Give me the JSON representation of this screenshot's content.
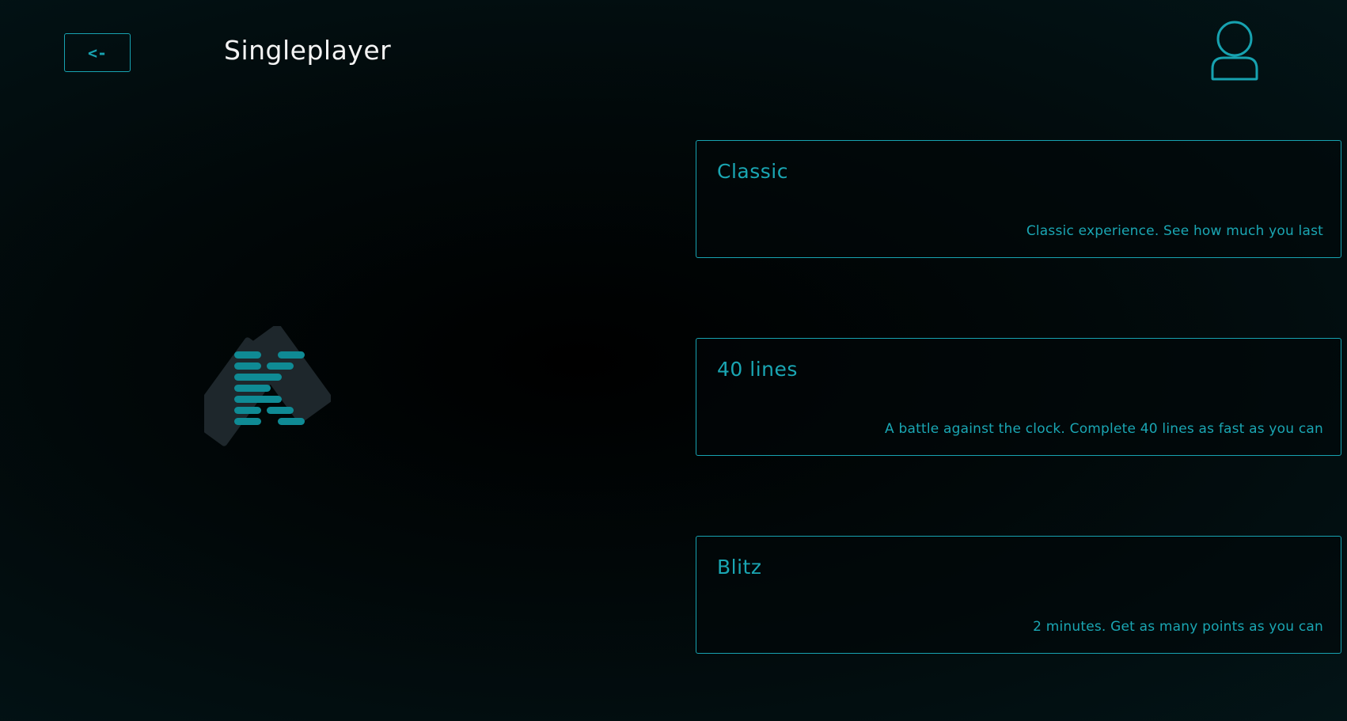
{
  "header": {
    "back_label": "<-",
    "title": "Singleplayer",
    "profile_icon": "user-icon"
  },
  "logo": {
    "icon": "tetris-logo-icon"
  },
  "modes": [
    {
      "title": "Classic",
      "description": "Classic experience. See how much you last"
    },
    {
      "title": "40 lines",
      "description": "A battle against the clock. Complete 40 lines as fast as you can"
    },
    {
      "title": "Blitz",
      "description": "2 minutes. Get as many points as you can"
    }
  ],
  "colors": {
    "accent": "#17a2b0",
    "title_text": "#f4f4f4",
    "background": "#02090b",
    "logo_shape": "#1e272c",
    "logo_bars": "#0f8a94"
  }
}
